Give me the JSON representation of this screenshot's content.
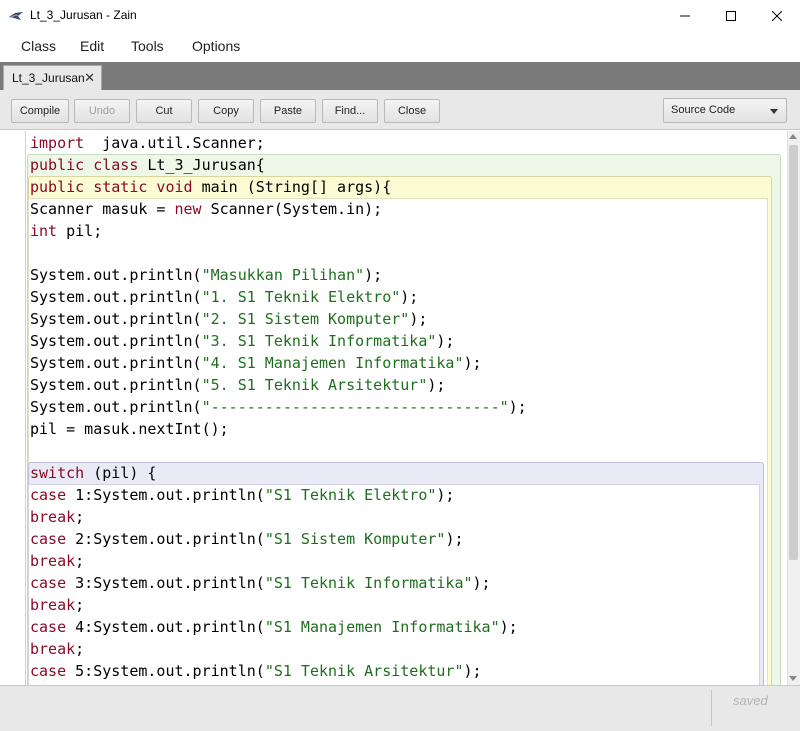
{
  "window": {
    "title": "Lt_3_Jurusan - Zain",
    "icon": "bluej-bird-icon"
  },
  "menu": {
    "items": [
      "Class",
      "Edit",
      "Tools",
      "Options"
    ]
  },
  "tabs": [
    {
      "label": "Lt_3_Jurusan",
      "close": "✕"
    }
  ],
  "toolbar": {
    "compile": "Compile",
    "undo": "Undo",
    "cut": "Cut",
    "copy": "Copy",
    "paste": "Paste",
    "find": "Find...",
    "close": "Close",
    "view_select": "Source Code"
  },
  "editor": {
    "lines": [
      [
        [
          "kw",
          "import"
        ],
        [
          "",
          "  java.util.Scanner;"
        ]
      ],
      [
        [
          "kw",
          "public class"
        ],
        [
          "",
          " Lt_3_Jurusan{"
        ]
      ],
      [
        [
          "kw",
          "public static void"
        ],
        [
          "",
          " main (String[] args){"
        ]
      ],
      [
        [
          "",
          "Scanner masuk = "
        ],
        [
          "kw",
          "new"
        ],
        [
          "",
          " Scanner(System.in);"
        ]
      ],
      [
        [
          "kw",
          "int"
        ],
        [
          "",
          " pil;"
        ]
      ],
      [
        [
          "",
          ""
        ]
      ],
      [
        [
          "",
          "System.out.println("
        ],
        [
          "str",
          "\"Masukkan Pilihan\""
        ],
        [
          "",
          ");"
        ]
      ],
      [
        [
          "",
          "System.out.println("
        ],
        [
          "str",
          "\"1. S1 Teknik Elektro\""
        ],
        [
          "",
          ");"
        ]
      ],
      [
        [
          "",
          "System.out.println("
        ],
        [
          "str",
          "\"2. S1 Sistem Komputer\""
        ],
        [
          "",
          ");"
        ]
      ],
      [
        [
          "",
          "System.out.println("
        ],
        [
          "str",
          "\"3. S1 Teknik Informatika\""
        ],
        [
          "",
          ");"
        ]
      ],
      [
        [
          "",
          "System.out.println("
        ],
        [
          "str",
          "\"4. S1 Manajemen Informatika\""
        ],
        [
          "",
          ");"
        ]
      ],
      [
        [
          "",
          "System.out.println("
        ],
        [
          "str",
          "\"5. S1 Teknik Arsitektur\""
        ],
        [
          "",
          ");"
        ]
      ],
      [
        [
          "",
          "System.out.println("
        ],
        [
          "str",
          "\"--------------------------------\""
        ],
        [
          "",
          ");"
        ]
      ],
      [
        [
          "",
          "pil = masuk.nextInt();"
        ]
      ],
      [
        [
          "",
          ""
        ]
      ],
      [
        [
          "kw",
          "switch"
        ],
        [
          "",
          " (pil) {"
        ]
      ],
      [
        [
          "kw",
          "case"
        ],
        [
          "",
          " 1:System.out.println("
        ],
        [
          "str",
          "\"S1 Teknik Elektro\""
        ],
        [
          "",
          ");"
        ]
      ],
      [
        [
          "kw",
          "break"
        ],
        [
          "",
          ";"
        ]
      ],
      [
        [
          "kw",
          "case"
        ],
        [
          "",
          " 2:System.out.println("
        ],
        [
          "str",
          "\"S1 Sistem Komputer\""
        ],
        [
          "",
          ");"
        ]
      ],
      [
        [
          "kw",
          "break"
        ],
        [
          "",
          ";"
        ]
      ],
      [
        [
          "kw",
          "case"
        ],
        [
          "",
          " 3:System.out.println("
        ],
        [
          "str",
          "\"S1 Teknik Informatika\""
        ],
        [
          "",
          ");"
        ]
      ],
      [
        [
          "kw",
          "break"
        ],
        [
          "",
          ";"
        ]
      ],
      [
        [
          "kw",
          "case"
        ],
        [
          "",
          " 4:System.out.println("
        ],
        [
          "str",
          "\"S1 Manajemen Informatika\""
        ],
        [
          "",
          ");"
        ]
      ],
      [
        [
          "kw",
          "break"
        ],
        [
          "",
          ";"
        ]
      ],
      [
        [
          "kw",
          "case"
        ],
        [
          "",
          " 5:System.out.println("
        ],
        [
          "str",
          "\"S1 Teknik Arsitektur\""
        ],
        [
          "",
          ");"
        ]
      ]
    ]
  },
  "status": {
    "text": "saved"
  },
  "colors": {
    "keyword": "#8b0a26",
    "string": "#1f6e1f",
    "class_scope": "#edf8e8",
    "method_scope": "#fbfbd4",
    "switch_scope": "#eaeaf6"
  }
}
